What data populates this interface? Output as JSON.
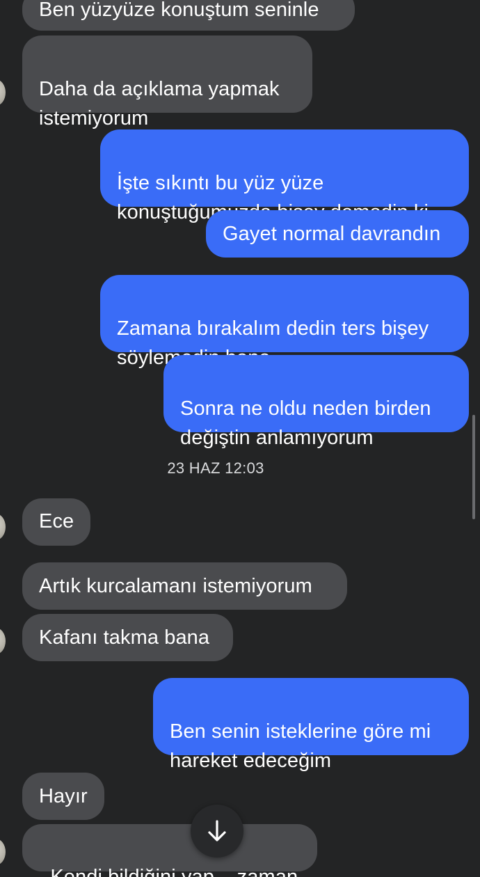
{
  "messages": [
    {
      "from": "them",
      "text": "Ben yüzyüze konuştum seninle"
    },
    {
      "from": "them",
      "text": "Daha da açıklama yapmak\nistemiyorum"
    },
    {
      "from": "me",
      "text": "İşte sıkıntı bu yüz yüze\nkonuştuğumuzda bişey demedin ki"
    },
    {
      "from": "me",
      "text": "Gayet normal davrandın"
    },
    {
      "from": "me",
      "text": "Zamana bırakalım dedin ters bişey\nsöylemedin bana"
    },
    {
      "from": "me",
      "text": "Sonra ne oldu neden birden\ndeğiştin anlamıyorum"
    },
    {
      "from": "them",
      "text": "Ece"
    },
    {
      "from": "them",
      "text": "Artık kurcalamanı istemiyorum"
    },
    {
      "from": "them",
      "text": "Kafanı takma bana"
    },
    {
      "from": "me",
      "text": "Ben senin isteklerine göre mi\nhareket edeceğim"
    },
    {
      "from": "them",
      "text": "Hayır"
    },
    {
      "from": "them",
      "text": "Kendi bildiğini yap    zaman"
    }
  ],
  "timestamp": "23 HAZ 12:03",
  "colors": {
    "background": "#232425",
    "received_bubble": "#4a4b4e",
    "sent_bubble": "#3a6cf7",
    "text": "#ffffff"
  },
  "icons": {
    "scroll_down": "arrow-down-icon"
  }
}
